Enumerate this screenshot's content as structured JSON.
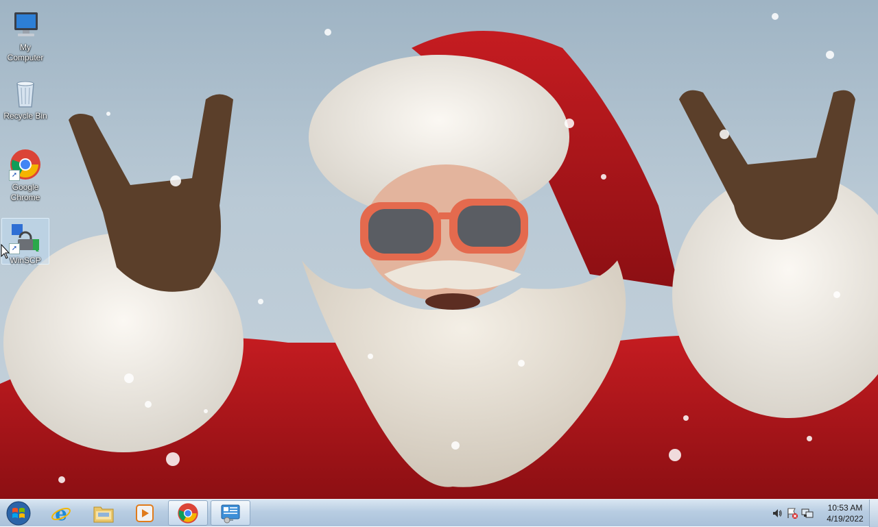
{
  "desktop": {
    "icons": [
      {
        "label": "My Computer",
        "icon": "computer-icon"
      },
      {
        "label": "Recycle Bin",
        "icon": "recycle-bin-icon"
      },
      {
        "label": "Google Chrome",
        "icon": "chrome-icon"
      },
      {
        "label": "WinSCP",
        "icon": "winscp-icon"
      }
    ],
    "selected_icon": "WinSCP"
  },
  "taskbar": {
    "start": {
      "icon": "windows-logo-icon"
    },
    "pinned": [
      {
        "name": "Internet Explorer",
        "icon": "internet-explorer-icon",
        "open": false
      },
      {
        "name": "Windows Explorer",
        "icon": "folder-icon",
        "open": false
      },
      {
        "name": "Windows Media Player",
        "icon": "media-player-icon",
        "open": false
      },
      {
        "name": "Google Chrome",
        "icon": "chrome-icon",
        "open": true
      },
      {
        "name": "Control Panel",
        "icon": "control-panel-icon",
        "open": true
      }
    ],
    "tray": {
      "icons": [
        "volume-icon",
        "action-center-icon",
        "network-icon"
      ],
      "time": "10:53 AM",
      "date": "4/19/2022"
    }
  },
  "colors": {
    "taskbar": "#b8cde2",
    "sky": "#b9c9d5",
    "santa_red": "#b3161b"
  }
}
